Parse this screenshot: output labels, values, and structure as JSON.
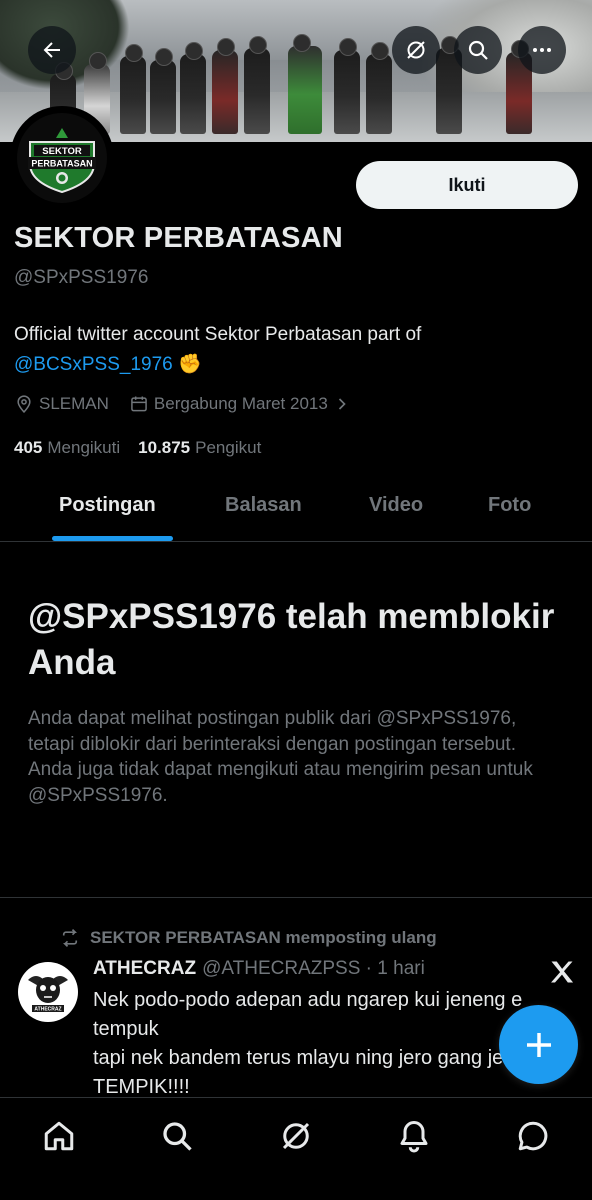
{
  "header": {
    "back_icon": "arrow-left-icon",
    "grok_icon": "grok-icon",
    "search_icon": "search-icon",
    "more_icon": "more-horizontal-icon"
  },
  "profile": {
    "avatar_text_line1": "SEKTOR",
    "avatar_text_line2": "PERBATASAN",
    "follow_label": "Ikuti",
    "display_name": "SEKTOR PERBATASAN",
    "handle": "@SPxPSS1976",
    "bio_text": "Official twitter account Sektor Perbatasan part of",
    "bio_mention": "@BCSxPSS_1976",
    "bio_emoji": "✊",
    "location": "SLEMAN",
    "joined": "Bergabung Maret 2013",
    "following_count": "405",
    "following_label": "Mengikuti",
    "followers_count": "10.875",
    "followers_label": "Pengikut"
  },
  "tabs": [
    {
      "label": "Postingan",
      "active": true
    },
    {
      "label": "Balasan",
      "active": false
    },
    {
      "label": "Video",
      "active": false
    },
    {
      "label": "Foto",
      "active": false
    }
  ],
  "block_notice": {
    "title": "@SPxPSS1976 telah memblokir Anda",
    "description": "Anda dapat melihat postingan publik dari @SPxPSS1976, tetapi diblokir dari berinteraksi dengan postingan tersebut. Anda juga tidak dapat mengikuti atau mengirim pesan untuk @SPxPSS1976."
  },
  "post": {
    "repost_label": "SEKTOR PERBATASAN memposting ulang",
    "author_name": "ATHECRAZ",
    "author_handle": "@ATHECRAZPSS",
    "time": "· 1 hari",
    "avatar_text": "ATHECRAZ",
    "text_line1": "Nek podo-podo adepan adu ngarep kui jeneng e tempuk",
    "text_line2": "tapi nek bandem terus mlayu ning jero gang jeneng e TEMPIK!!!!"
  },
  "bottom_nav": [
    "home-icon",
    "search-icon",
    "grok-icon",
    "notifications-icon",
    "messages-icon"
  ],
  "colors": {
    "accent": "#1d9bf0",
    "background": "#000000",
    "text_primary": "#e7e9ea",
    "text_secondary": "#71767b",
    "border": "#2f3336"
  }
}
